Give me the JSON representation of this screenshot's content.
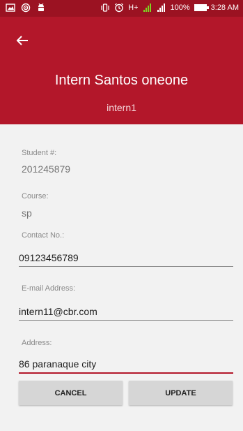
{
  "status_bar": {
    "battery_text": "100%",
    "time": "3:28 AM",
    "network_label": "H+"
  },
  "header": {
    "title": "Intern Santos oneone",
    "subtitle": "intern1"
  },
  "form": {
    "student_label": "Student #:",
    "student_value": "201245879",
    "course_label": "Course:",
    "course_value": "sp",
    "contact_label": "Contact No.:",
    "contact_value": "09123456789",
    "email_label": "E-mail Address:",
    "email_value": "intern11@cbr.com",
    "address_label": "Address:",
    "address_value": "86 paranaque city"
  },
  "actions": {
    "cancel_label": "CANCEL",
    "update_label": "UPDATE"
  },
  "colors": {
    "primary": "#b3172a",
    "status_bar": "#9b1222",
    "background": "#f2f2f2",
    "button": "#d6d6d6"
  }
}
